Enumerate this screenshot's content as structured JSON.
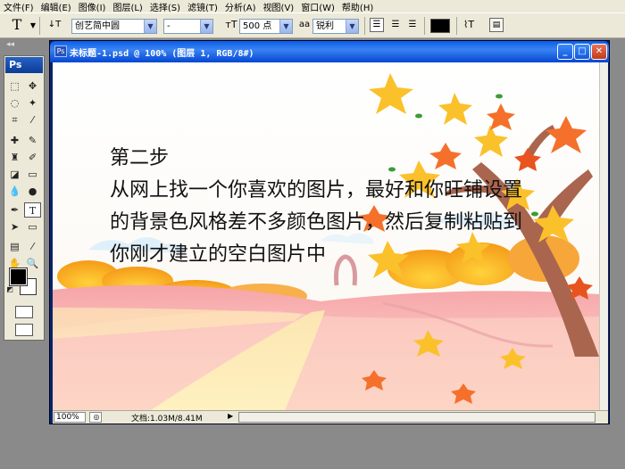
{
  "menu": [
    "文件(F)",
    "编辑(E)",
    "图像(I)",
    "图层(L)",
    "选择(S)",
    "滤镜(T)",
    "分析(A)",
    "视图(V)",
    "窗口(W)",
    "帮助(H)"
  ],
  "options": {
    "tool_icon": "T",
    "font_family": "创艺简中圆",
    "font_style": "-",
    "font_size": "500 点",
    "aa_label": "a",
    "aa_mode": "锐利",
    "color": "#000000"
  },
  "tools": {
    "logo": "Ps",
    "fg_color": "#000000",
    "bg_color": "#ffffff"
  },
  "document": {
    "title": "未标题-1.psd @ 100% (图层 1, RGB/8#)"
  },
  "canvas_text": {
    "line1": "第二步",
    "line2": "从网上找一个你喜欢的图片，最好和你旺铺设置",
    "line3": "的背景色风格差不多颜色图片，然后复制粘贴到",
    "line4": "你刚才建立的空白图片中"
  },
  "status": {
    "zoom": "100%",
    "doc_info": "文档:1.03M/8.41M"
  }
}
